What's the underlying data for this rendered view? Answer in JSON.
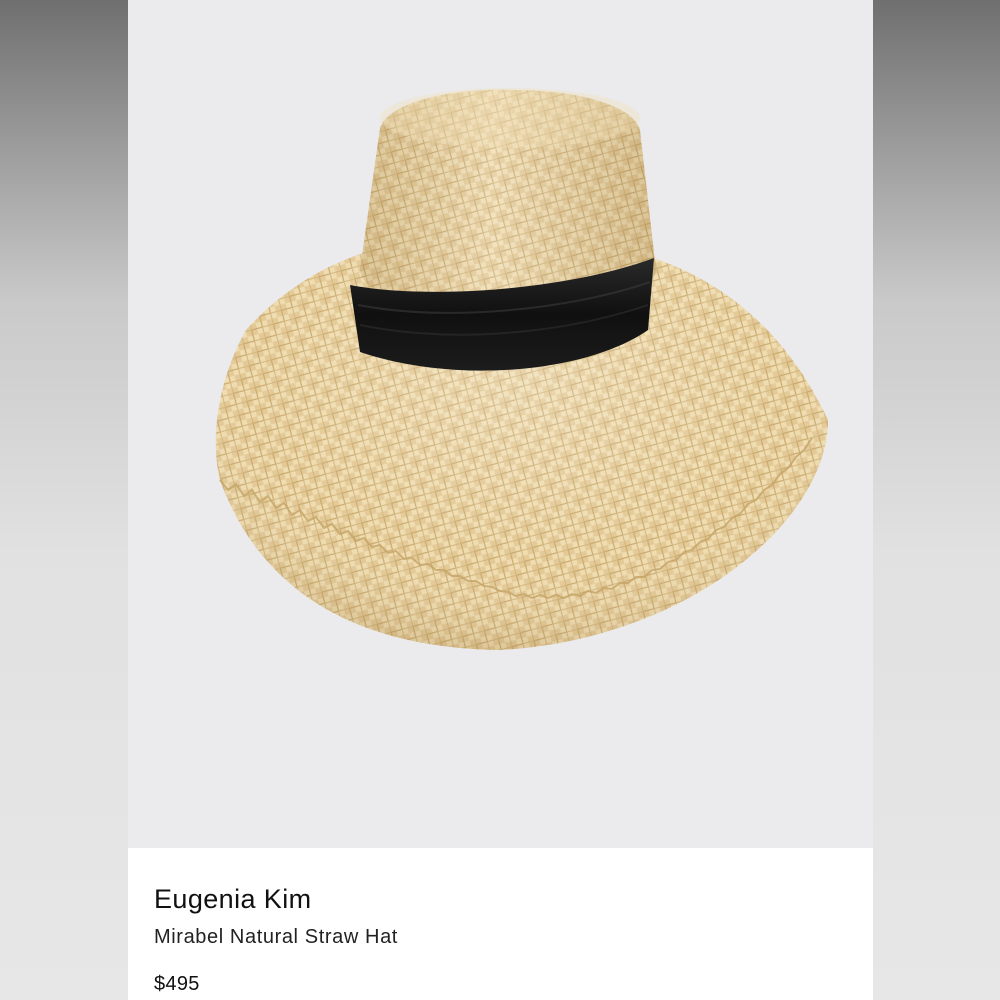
{
  "product": {
    "brand": "Eugenia Kim",
    "name": "Mirabel Natural Straw Hat",
    "price": "$495",
    "image": {
      "subject": "straw-hat",
      "straw_color": "#e6cf9c",
      "band_color": "#141414",
      "background_color": "#ebebed"
    }
  }
}
